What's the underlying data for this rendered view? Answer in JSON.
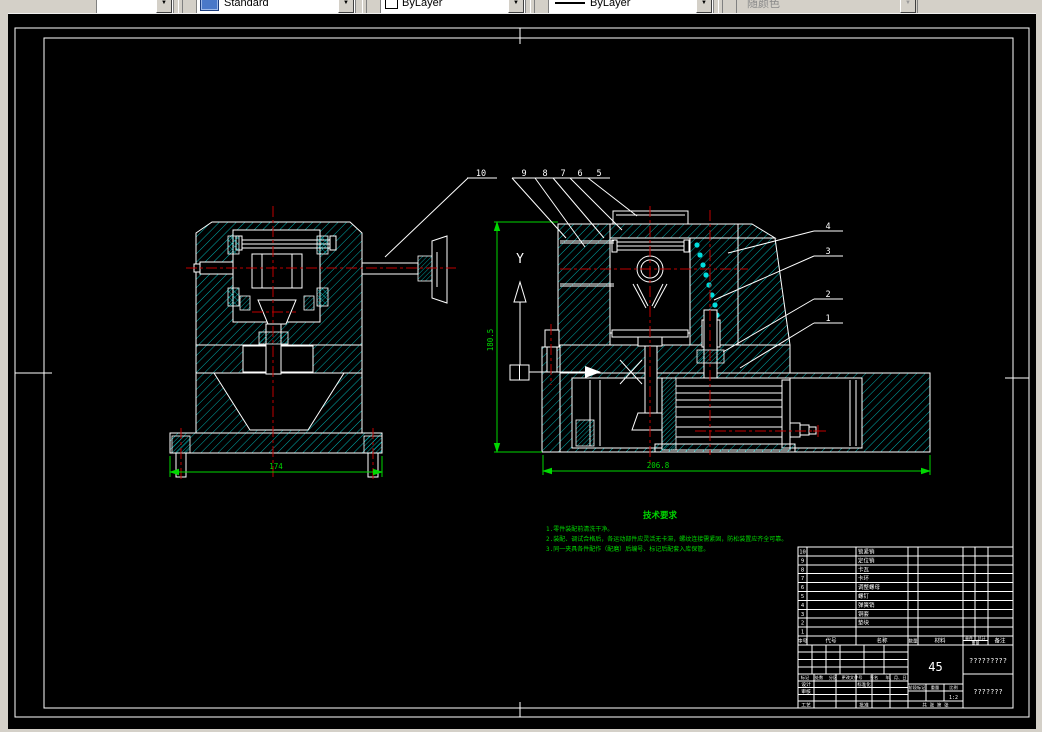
{
  "toolbar": {
    "style_value": "Standard",
    "color_value": "ByLayer",
    "linetype_value": "ByLayer",
    "plot_style_value": "随颜色"
  },
  "drawing": {
    "callouts": [
      "10",
      "9",
      "8",
      "7",
      "6",
      "5",
      "4",
      "3",
      "2",
      "1"
    ],
    "dims": {
      "front_width": "174",
      "side_width": "206.8",
      "side_height": "180.5"
    },
    "axes": {
      "vertical": "Y"
    },
    "notes": {
      "title": "技术要求",
      "items": [
        "1.零件装配前清洗干净。",
        "2.装配、调试合格后，各运动部件应灵活无卡滞，螺纹连接需紧固，防松装置应齐全可靠。",
        "3.同一夹具各件配作（配磨）后编号、标记后配套入库保管。"
      ]
    }
  },
  "bom": {
    "headers": {
      "seq": "序号",
      "code": "代号",
      "name": "名称",
      "qty": "数量",
      "material": "材料",
      "unit": "单件",
      "total": "总计",
      "weight": "重量",
      "remark": "备注"
    },
    "rows": [
      {
        "seq": "10",
        "name": "锁紧销"
      },
      {
        "seq": "9",
        "name": "定位销"
      },
      {
        "seq": "8",
        "name": "卡瓦"
      },
      {
        "seq": "7",
        "name": "卡环"
      },
      {
        "seq": "6",
        "name": "调整螺母"
      },
      {
        "seq": "5",
        "name": "螺钉"
      },
      {
        "seq": "4",
        "name": "弹簧销"
      },
      {
        "seq": "3",
        "name": "铜套"
      },
      {
        "seq": "2",
        "name": "垫块"
      },
      {
        "seq": "1",
        "name": ""
      }
    ]
  },
  "titleblock": {
    "material_value": "45",
    "doc_name": "?????????",
    "doc_code": "???????",
    "scale_value": "1:2",
    "sheet": "共 张 第 张",
    "labels": {
      "mark": "标记",
      "count": "处数",
      "zone": "分区",
      "change_doc": "更改文件号",
      "sign": "签名",
      "date": "年、月、日",
      "design": "设计",
      "standardize": "标准化",
      "audit": "审核",
      "process": "工艺",
      "approve": "批准",
      "stage": "阶段标记",
      "weight": "重量",
      "scale": "比例"
    }
  }
}
